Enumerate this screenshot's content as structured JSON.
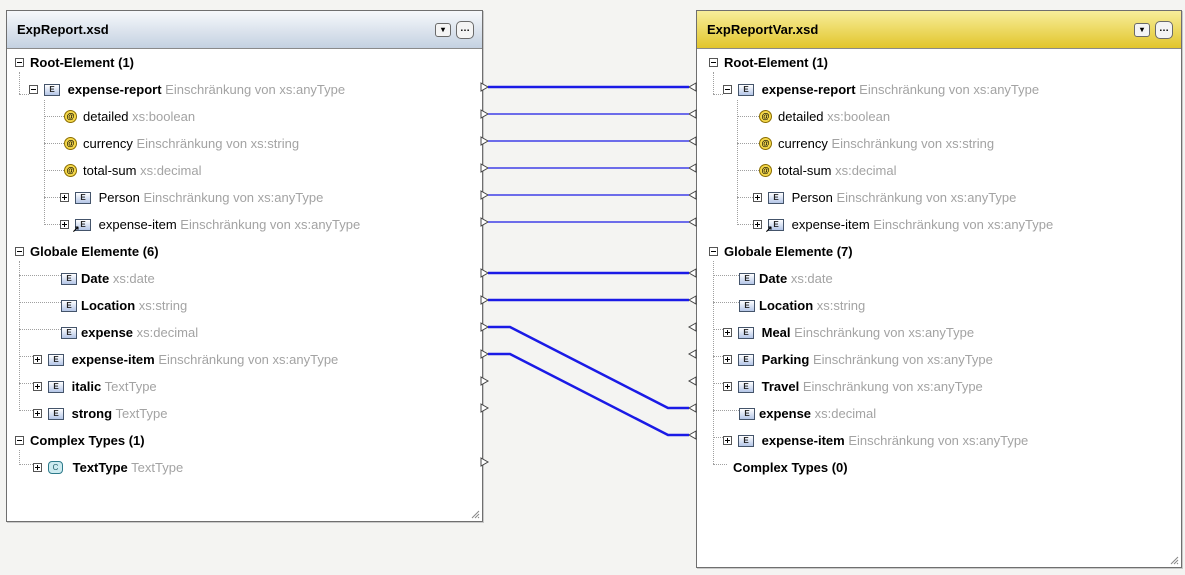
{
  "left": {
    "title": "ExpReport.xsd",
    "root_header": "Root-Element (1)",
    "root": {
      "name": "expense-report",
      "type": "Einschränkung von xs:anyType"
    },
    "attrs": [
      {
        "name": "detailed",
        "type": "xs:boolean"
      },
      {
        "name": "currency",
        "type": "Einschränkung von xs:string"
      },
      {
        "name": "total-sum",
        "type": "xs:decimal"
      }
    ],
    "children": [
      {
        "name": "Person",
        "type": "Einschränkung von xs:anyType"
      },
      {
        "name": "expense-item",
        "type": "Einschränkung von xs:anyType"
      }
    ],
    "globals_header": "Globale Elemente (6)",
    "globals": [
      {
        "name": "Date",
        "type": "xs:date"
      },
      {
        "name": "Location",
        "type": "xs:string"
      },
      {
        "name": "expense",
        "type": "xs:decimal"
      },
      {
        "name": "expense-item",
        "type": "Einschränkung von xs:anyType"
      },
      {
        "name": "italic",
        "type": "TextType"
      },
      {
        "name": "strong",
        "type": "TextType"
      }
    ],
    "complex_header": "Complex Types (1)",
    "complex": [
      {
        "name": "TextType",
        "type": "TextType"
      }
    ]
  },
  "right": {
    "title": "ExpReportVar.xsd",
    "root_header": "Root-Element (1)",
    "root": {
      "name": "expense-report",
      "type": "Einschränkung von xs:anyType"
    },
    "attrs": [
      {
        "name": "detailed",
        "type": "xs:boolean"
      },
      {
        "name": "currency",
        "type": "Einschränkung von xs:string"
      },
      {
        "name": "total-sum",
        "type": "xs:decimal"
      }
    ],
    "children": [
      {
        "name": "Person",
        "type": "Einschränkung von xs:anyType"
      },
      {
        "name": "expense-item",
        "type": "Einschränkung von xs:anyType"
      }
    ],
    "globals_header": "Globale Elemente (7)",
    "globals": [
      {
        "name": "Date",
        "type": "xs:date"
      },
      {
        "name": "Location",
        "type": "xs:string"
      },
      {
        "name": "Meal",
        "type": "Einschränkung von xs:anyType"
      },
      {
        "name": "Parking",
        "type": "Einschränkung von xs:anyType"
      },
      {
        "name": "Travel",
        "type": "Einschränkung von xs:anyType"
      },
      {
        "name": "expense",
        "type": "xs:decimal"
      },
      {
        "name": "expense-item",
        "type": "Einschränkung von xs:anyType"
      }
    ],
    "complex_header": "Complex Types (0)"
  },
  "icons": {
    "element": "E",
    "attribute": "@",
    "complex": "C",
    "dropdown": "▾",
    "more": "…"
  },
  "link_color": "#1a1ae6"
}
